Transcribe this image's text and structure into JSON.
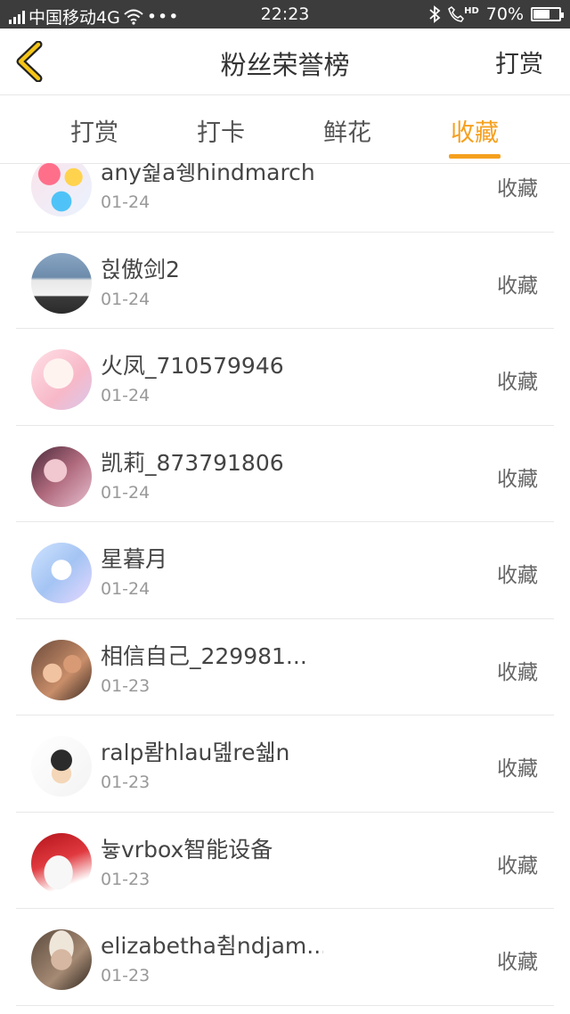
{
  "status_bar": {
    "carrier": "中国移动4G",
    "network": "4G",
    "time": "22:23",
    "battery": "70%",
    "battery_level": 0.7,
    "hd": "HD"
  },
  "header": {
    "title": "粉丝荣誉榜",
    "action_label": "打赏"
  },
  "tabs": [
    {
      "label": "打赏"
    },
    {
      "label": "打卡"
    },
    {
      "label": "鲜花"
    },
    {
      "label": "收藏"
    }
  ],
  "active_tab": "收藏",
  "accent_color": "#f5a01f",
  "list": [
    {
      "name": "any쉁a쉥hindmarch",
      "date": "01-24",
      "type": "收藏"
    },
    {
      "name": "힍傲剑2",
      "date": "01-24",
      "type": "收藏"
    },
    {
      "name": "火凤_710579946",
      "date": "01-24",
      "type": "收藏"
    },
    {
      "name": "凯莉_873791806",
      "date": "01-24",
      "type": "收藏"
    },
    {
      "name": "星暮月",
      "date": "01-24",
      "type": "收藏"
    },
    {
      "name": "相信自己_229981...",
      "date": "01-23",
      "type": "收藏"
    },
    {
      "name": "ralp뢈hlau뎶re쉛n",
      "date": "01-23",
      "type": "收藏"
    },
    {
      "name": "늏vrbox智能设备",
      "date": "01-23",
      "type": "收藏"
    },
    {
      "name": "elizabetha췸ndjam...",
      "date": "01-23",
      "type": "收藏"
    }
  ]
}
